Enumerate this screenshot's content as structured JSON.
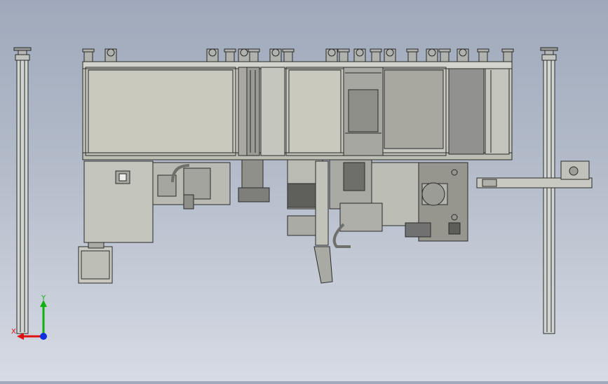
{
  "viewport": {
    "background_top": "#9fa9bb",
    "background_bottom": "#d6dbe4",
    "line_color": "#2a2a2a",
    "panel_color": "#c9c9bd",
    "panel_dark": "#8e8e88",
    "panel_mid": "#a9a9a2"
  },
  "triad": {
    "x_label": "X",
    "y_label": "Y",
    "x_color": "#e01010",
    "y_color": "#10b010",
    "z_color": "#1030e0",
    "x_icon": "x-axis-arrow-icon",
    "y_icon": "y-axis-arrow-icon",
    "z_icon": "z-axis-dot-icon"
  }
}
